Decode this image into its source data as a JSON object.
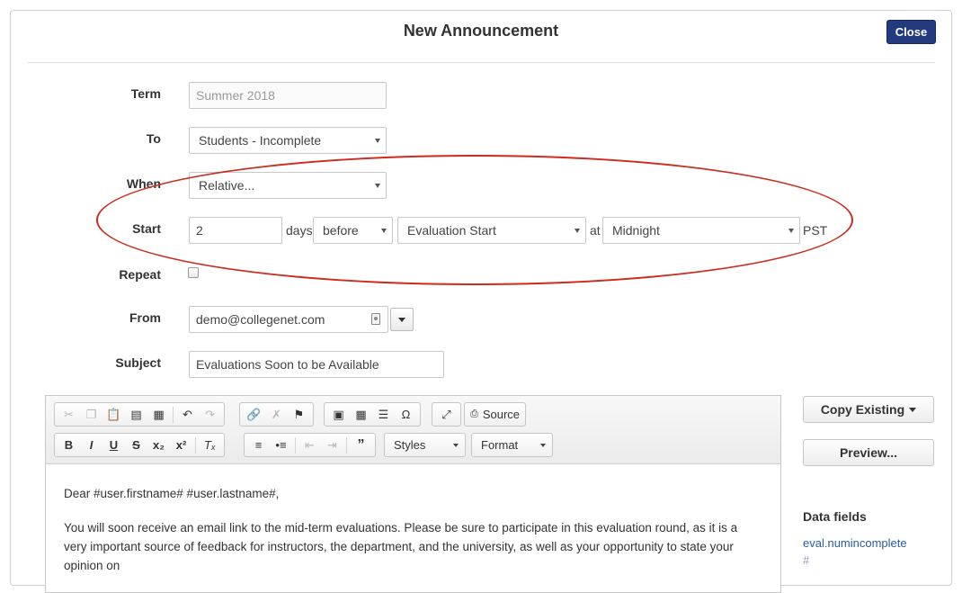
{
  "modal": {
    "title": "New Announcement",
    "close_label": "Close"
  },
  "form": {
    "term_label": "Term",
    "term_value": "Summer 2018",
    "to_label": "To",
    "to_value": "Students - Incomplete",
    "when_label": "When",
    "when_value": "Relative...",
    "start_label": "Start",
    "start_amount": "2",
    "start_unit": "days",
    "start_direction": "before",
    "start_event": "Evaluation Start",
    "at_label": "at",
    "start_time": "Midnight",
    "timezone": "PST",
    "repeat_label": "Repeat",
    "repeat_checked": false,
    "from_label": "From",
    "from_value": "demo@collegenet.com",
    "subject_label": "Subject",
    "subject_value": "Evaluations Soon to be Available"
  },
  "editor": {
    "source_label": "Source",
    "styles_label": "Styles",
    "format_label": "Format",
    "body": [
      "Dear #user.firstname# #user.lastname#,",
      "You will soon receive an email link to the mid-term evaluations. Please be sure to participate in this evaluation round, as it is a very important source of feedback for instructors, the department, and the university, as well as your opportunity to state your opinion on"
    ]
  },
  "sidebar": {
    "copy_existing_label": "Copy Existing",
    "preview_label": "Preview...",
    "data_fields_title": "Data fields",
    "data_fields": [
      "eval.numincomplete",
      "#"
    ]
  },
  "colors": {
    "primary": "#233a7e",
    "highlight": "#cc2b1d",
    "link": "#2a5aa8"
  },
  "icons": {
    "from_field": "contact-card-icon",
    "toolbar": [
      "cut-icon",
      "copy-icon",
      "paste-icon",
      "paste-text-icon",
      "paste-word-icon",
      "undo-icon",
      "redo-icon",
      "link-icon",
      "unlink-icon",
      "anchor-flag-icon",
      "image-icon",
      "table-icon",
      "horizontal-rule-icon",
      "special-char-icon",
      "maximize-icon",
      "source-icon",
      "bold-icon",
      "italic-icon",
      "underline-icon",
      "strike-icon",
      "subscript-icon",
      "superscript-icon",
      "remove-format-icon",
      "numbered-list-icon",
      "bulleted-list-icon",
      "outdent-icon",
      "indent-icon",
      "blockquote-icon"
    ]
  }
}
